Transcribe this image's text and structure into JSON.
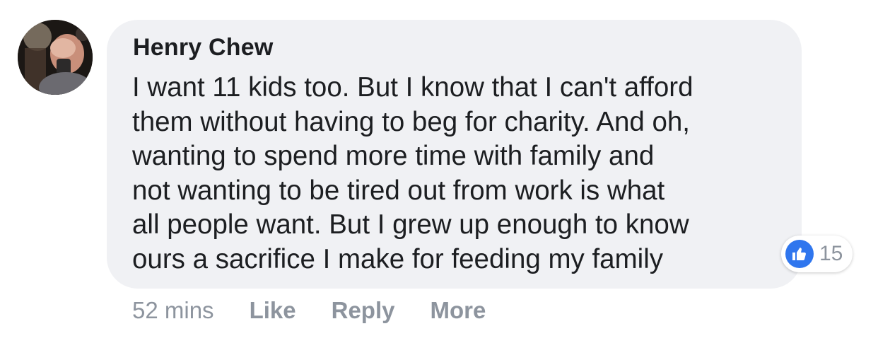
{
  "comment": {
    "author": "Henry Chew",
    "avatar_icon": "avatar-photo",
    "lines": [
      "I want 11 kids too. But I know that I can't afford",
      "them without having to beg for charity. And oh,",
      "wanting to spend more time with family and",
      "not wanting to be tired out from work is what",
      "all people want. But I grew up enough to know",
      "ours a sacrifice I make for feeding my family"
    ],
    "reactions": {
      "icon": "thumbs-up-icon",
      "count": "15",
      "color": "#2f76ee"
    },
    "timestamp": "52 mins",
    "actions": {
      "like_label": "Like",
      "reply_label": "Reply",
      "more_label": "More"
    }
  },
  "colors": {
    "bubble": "#f0f1f4",
    "text": "#1c1e21",
    "muted": "#8d949e"
  }
}
